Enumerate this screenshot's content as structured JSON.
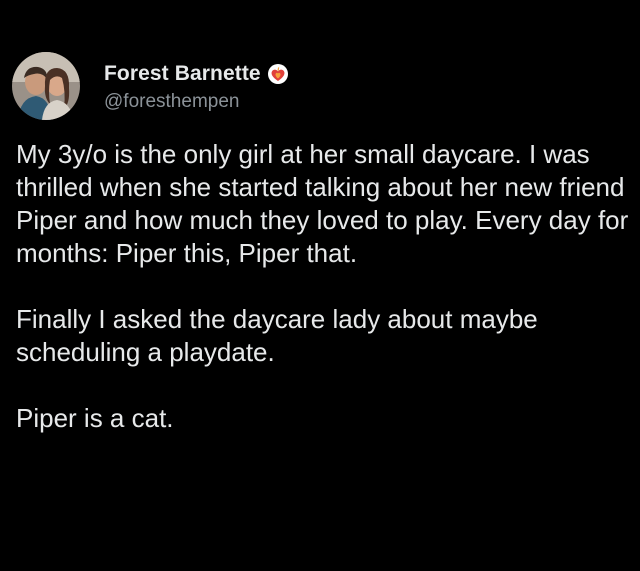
{
  "tweet": {
    "author": {
      "display_name": "Forest Barnette",
      "handle": "@foresthempen",
      "badge_icon": "heart-fire-badge-icon",
      "badge_color": "#e0413a"
    },
    "paragraphs": [
      "My 3y/o is the only girl at her small daycare. I was thrilled when she started talking about her new friend Piper and how much they loved to play. Every day for months: Piper this, Piper that.",
      "Finally I asked the daycare lady about maybe scheduling a playdate.",
      "Piper is a cat."
    ]
  },
  "colors": {
    "background": "#000000",
    "text": "#e7e9ea",
    "handle": "#8b9298"
  }
}
